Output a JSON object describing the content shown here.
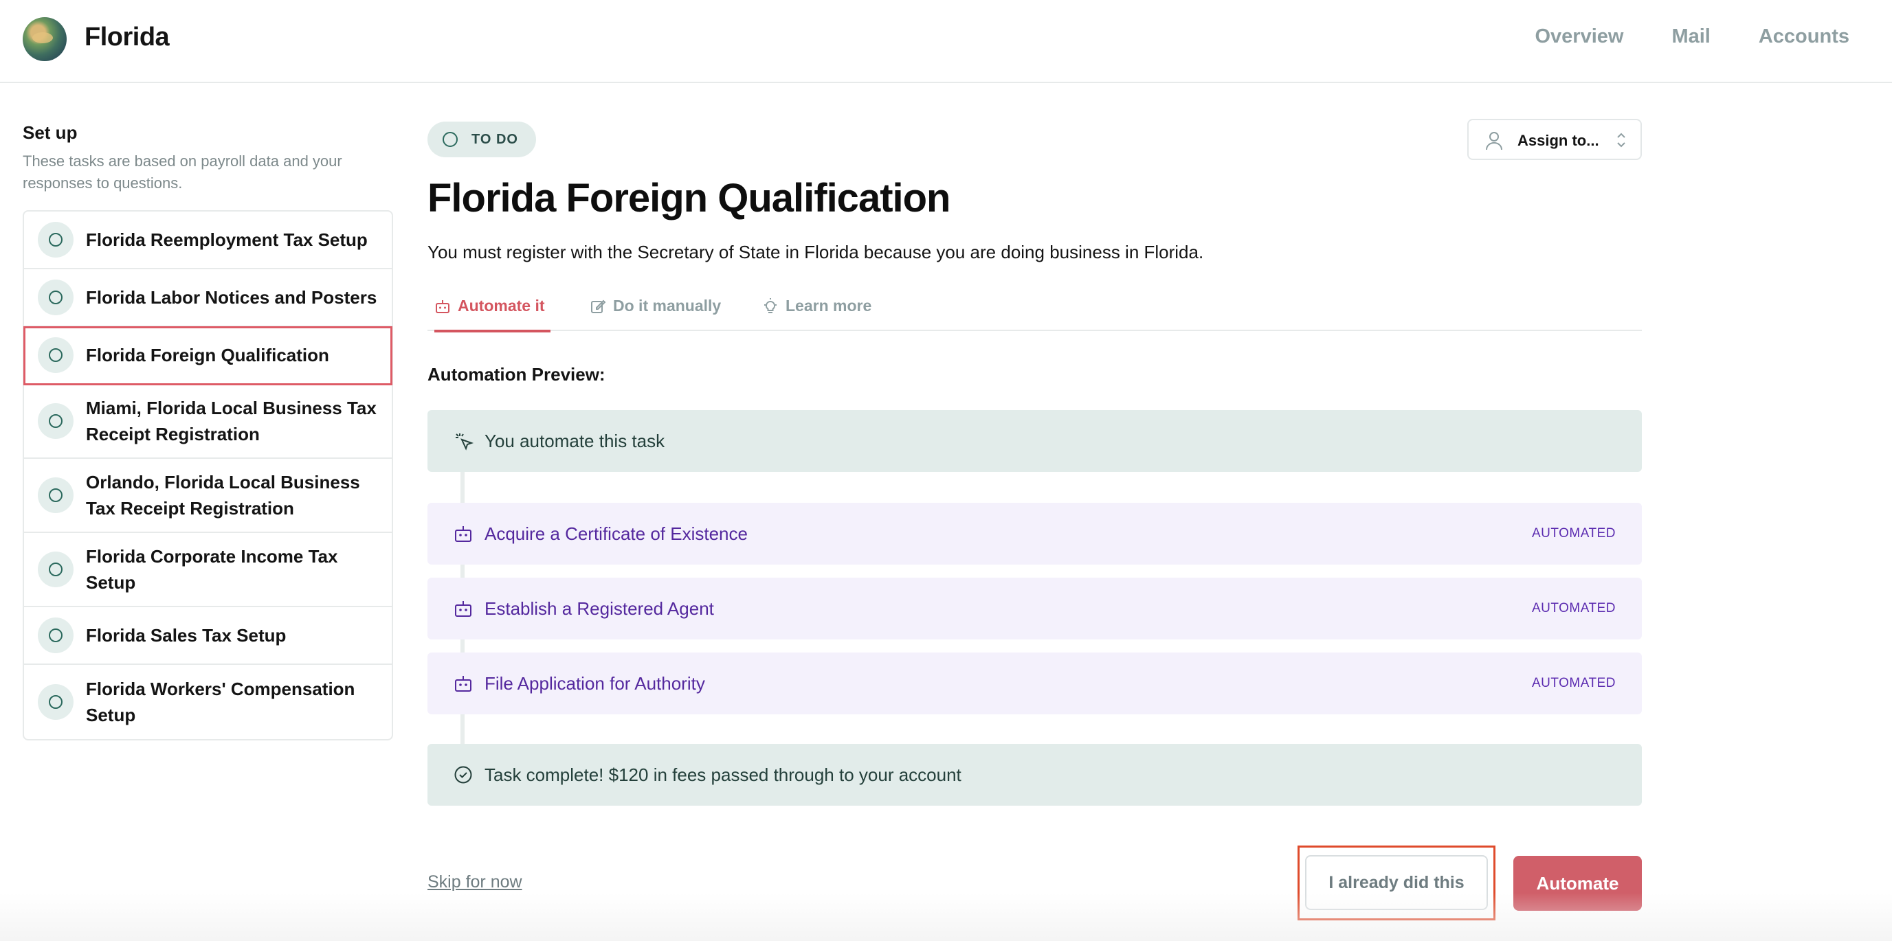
{
  "header": {
    "brand": "Florida",
    "nav": [
      "Overview",
      "Mail",
      "Accounts"
    ]
  },
  "sidebar": {
    "title": "Set up",
    "description": "These tasks are based on payroll data and your responses to questions.",
    "items": [
      {
        "label": "Florida Reemployment Tax Setup"
      },
      {
        "label": "Florida Labor Notices and Posters"
      },
      {
        "label": "Florida Foreign Qualification",
        "selected": true
      },
      {
        "label": "Miami, Florida Local Business Tax Receipt Registration"
      },
      {
        "label": "Orlando, Florida Local Business Tax Receipt Registration"
      },
      {
        "label": "Florida Corporate Income Tax Setup"
      },
      {
        "label": "Florida Sales Tax Setup"
      },
      {
        "label": "Florida Workers' Compensation Setup"
      }
    ]
  },
  "main": {
    "status": "TO DO",
    "assign_label": "Assign to...",
    "title": "Florida Foreign Qualification",
    "subtitle": "You must register with the Secretary of State in Florida because you are doing business in Florida.",
    "tabs": [
      {
        "label": "Automate it",
        "active": true
      },
      {
        "label": "Do it manually"
      },
      {
        "label": "Learn more"
      }
    ],
    "preview_label": "Automation Preview:",
    "steps": [
      {
        "text": "You automate this task",
        "icon": "cursor-click-icon"
      },
      {
        "text": "Acquire a Certificate of Existence",
        "tag": "AUTOMATED",
        "icon": "robot-icon"
      },
      {
        "text": "Establish a Registered Agent",
        "tag": "AUTOMATED",
        "icon": "robot-icon"
      },
      {
        "text": "File Application for Authority",
        "tag": "AUTOMATED",
        "icon": "robot-icon"
      },
      {
        "text": "Task complete! $120 in fees passed through to your account",
        "icon": "check-circle-icon"
      }
    ],
    "skip_label": "Skip for now",
    "already_label": "I already did this",
    "automate_label": "Automate"
  },
  "colors": {
    "accent_red": "#d05f69",
    "highlight_border": "#df4b2c",
    "green_bg": "#e2ecea",
    "purple_bg": "#f4f1fc",
    "purple_text": "#54289e"
  }
}
